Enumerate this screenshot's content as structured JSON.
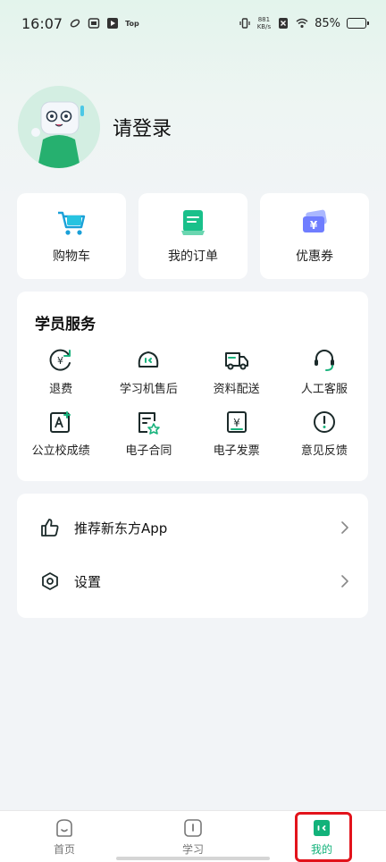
{
  "status_bar": {
    "time": "16:07",
    "app_tag": "Top",
    "net_speed_value": "881",
    "net_speed_unit": "KB/s",
    "battery": "85%"
  },
  "profile": {
    "login_text": "请登录"
  },
  "quick_actions": [
    {
      "label": "购物车",
      "icon": "shopping-cart-icon"
    },
    {
      "label": "我的订单",
      "icon": "order-icon"
    },
    {
      "label": "优惠券",
      "icon": "coupon-icon"
    }
  ],
  "services": {
    "title": "学员服务",
    "items": [
      {
        "label": "退费",
        "icon": "refund-icon"
      },
      {
        "label": "学习机售后",
        "icon": "device-support-icon"
      },
      {
        "label": "资料配送",
        "icon": "delivery-truck-icon"
      },
      {
        "label": "人工客服",
        "icon": "headset-icon"
      },
      {
        "label": "公立校成绩",
        "icon": "grade-icon"
      },
      {
        "label": "电子合同",
        "icon": "contract-icon"
      },
      {
        "label": "电子发票",
        "icon": "invoice-icon"
      },
      {
        "label": "意见反馈",
        "icon": "feedback-icon"
      }
    ]
  },
  "list": [
    {
      "label": "推荐新东方App",
      "icon": "thumbs-up-icon"
    },
    {
      "label": "设置",
      "icon": "settings-hexagon-icon"
    }
  ],
  "bottom_nav": [
    {
      "label": "首页",
      "icon": "home-icon",
      "active": false
    },
    {
      "label": "学习",
      "icon": "study-icon",
      "active": false
    },
    {
      "label": "我的",
      "icon": "me-icon",
      "active": true
    }
  ],
  "colors": {
    "accent": "#12b27a",
    "highlight": "#e2131b",
    "icon_stroke": "#1b2a2a"
  }
}
